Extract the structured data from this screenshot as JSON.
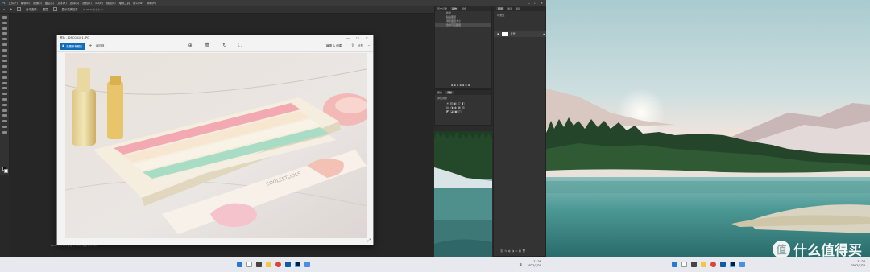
{
  "photoshop": {
    "menu": [
      "文件(F)",
      "编辑(E)",
      "图像(I)",
      "图层(L)",
      "文字(Y)",
      "选择(S)",
      "滤镜(T)",
      "3D(D)",
      "视图(V)",
      "增效工具",
      "窗口(W)",
      "帮助(H)"
    ],
    "options": {
      "auto_select": "自动选择:",
      "layer": "图层",
      "show_transform": "显示变换控件"
    },
    "history_panel": {
      "tabs": [
        "历史记录",
        "动作",
        "颜色"
      ],
      "items": [
        "新建",
        "粘贴图层",
        "调整图层大小",
        "合并可见图层"
      ]
    },
    "layers_panel": {
      "tabs": [
        "图层",
        "通道",
        "路径"
      ],
      "kind": "Q 类型",
      "layer_name": "背景"
    },
    "properties_panel": {
      "tabs": [
        "属性",
        "调整"
      ],
      "adjust_label": "添加调整"
    },
    "status_bar": "66.67%    5184 像素 x 3456 像素 (72 ppi)"
  },
  "viewer": {
    "title": "照片 - DSC04101.JPG",
    "save_button": "查看所有照片",
    "add_to": "添加到",
    "edit_button": "编辑 & 创建",
    "share_label": "分享",
    "photo_text": "COOLERTOOLS",
    "icons": [
      "zoom-icon",
      "delete-icon",
      "rotate-icon",
      "crop-icon"
    ]
  },
  "taskbar_left": {
    "sys": "英",
    "time": "11:28",
    "date": "2022/7/20"
  },
  "taskbar_right": {
    "time": "11:28",
    "date": "2022/7/20"
  },
  "watermark": {
    "logo": "值",
    "text": "什么值得买"
  },
  "colors": {
    "ps_accent": "#0f6cbd",
    "taskbar": "#e7e9ee"
  }
}
